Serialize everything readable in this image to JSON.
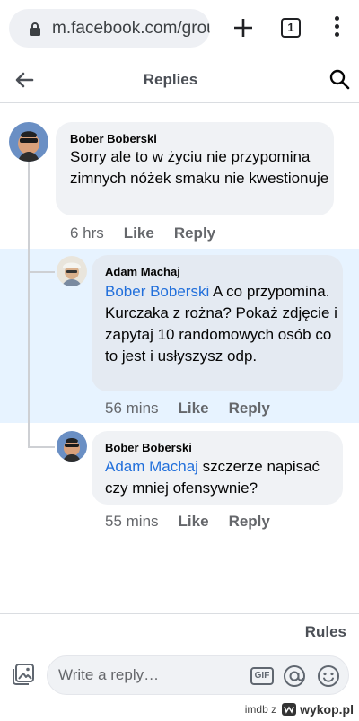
{
  "browser": {
    "url": "m.facebook.com/group",
    "tab_count": "1"
  },
  "header": {
    "title": "Replies"
  },
  "comments": [
    {
      "author": "Bober Boberski",
      "mention": "",
      "text": "Sorry ale to w życiu nie przypomina zimnych nóżek smaku nie kwestionuje",
      "time": "6 hrs",
      "like": "Like",
      "reply": "Reply"
    },
    {
      "author": "Adam Machaj",
      "mention": "Bober Boberski",
      "text": " A co przypomina. Kurczaka z rożna? Pokaż zdjęcie i zapytaj 10 randomowych osób co to jest i usłyszysz odp.",
      "time": "56 mins",
      "like": "Like",
      "reply": "Reply"
    },
    {
      "author": "Bober Boberski",
      "mention": "Adam Machaj",
      "text": " szczerze napisać czy mniej ofensywnie?",
      "time": "55 mins",
      "like": "Like",
      "reply": "Reply"
    }
  ],
  "footer": {
    "rules": "Rules",
    "placeholder": "Write a reply…",
    "gif_label": "GIF"
  },
  "watermark": {
    "prefix": "imdb z",
    "brand": "wykop.pl"
  },
  "colors": {
    "highlight": "#e7f3ff",
    "mention": "#216fdb",
    "bubble": "#f0f2f5"
  }
}
